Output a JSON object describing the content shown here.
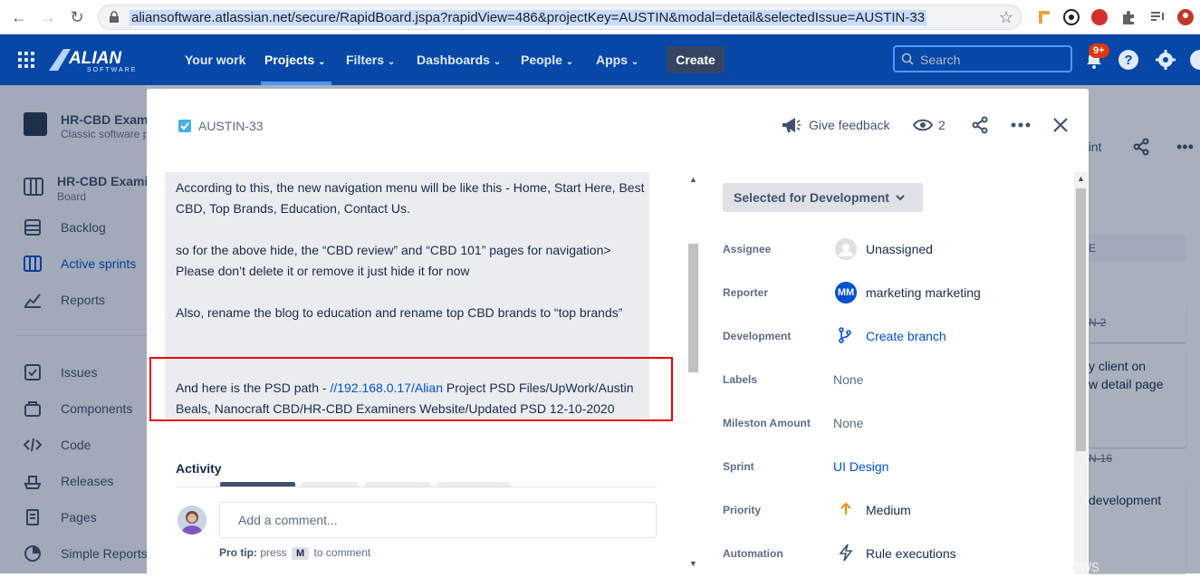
{
  "browser": {
    "url": "aliansoftware.atlassian.net/secure/RapidBoard.jspa?rapidView=486&projectKey=AUSTIN&modal=detail&selectedIssue=AUSTIN-33"
  },
  "topnav": {
    "logo": "ALIAN SOFTWARE",
    "items": [
      "Your work",
      "Projects",
      "Filters",
      "Dashboards",
      "People",
      "Apps"
    ],
    "create_label": "Create",
    "search_placeholder": "Search",
    "notification_count": "9+"
  },
  "sidebar": {
    "project_name": "HR-CBD Exami",
    "project_type": "Classic software p",
    "board_name": "HR-CBD Examir",
    "board_sub": "Board",
    "items": [
      {
        "label": "Backlog",
        "icon": "backlog-icon"
      },
      {
        "label": "Active sprints",
        "icon": "sprints-icon"
      },
      {
        "label": "Reports",
        "icon": "reports-icon"
      },
      {
        "label": "Issues",
        "icon": "issues-icon"
      },
      {
        "label": "Components",
        "icon": "components-icon"
      },
      {
        "label": "Code",
        "icon": "code-icon"
      },
      {
        "label": "Releases",
        "icon": "releases-icon"
      },
      {
        "label": "Pages",
        "icon": "pages-icon"
      },
      {
        "label": "Simple Reports",
        "icon": "simple-reports-icon"
      }
    ]
  },
  "background": {
    "sprint_btn": "rint",
    "card1_key": "N-2",
    "card2_line1": "y client on",
    "card2_line2": "w detail page",
    "card3_key": "N-16",
    "card4_line": "development",
    "col_letter": "E"
  },
  "modal": {
    "issue_key": "AUSTIN-33",
    "feedback_label": "Give feedback",
    "watch_count": "2",
    "description": {
      "p1": "According to this, the new navigation menu will be like this  - Home, Start Here, Best CBD, Top Brands, Education, Contact Us.",
      "p2": "so for the above hide, the “CBD review” and “CBD 101” pages for navigation> Please don’t delete it or remove it just hide it for now",
      "p3": "Also, rename the blog to education and rename top CBD brands to “top brands”",
      "p4_prefix": "And here is the PSD path  - ",
      "p4_link": "//192.168.0.17/Alian",
      "p4_suffix": " Project PSD Files/UpWork/Austin Beals, Nanocraft CBD/HR-CBD Examiners Website/Updated PSD 12-10-2020"
    },
    "activity_title": "Activity",
    "comment_placeholder": "Add a comment...",
    "pro_tip_label": "Pro tip:",
    "pro_tip_press": "press",
    "pro_tip_key": "M",
    "pro_tip_suffix": "to comment",
    "status": "Selected for Development",
    "fields": {
      "assignee": {
        "label": "Assignee",
        "value": "Unassigned"
      },
      "reporter": {
        "label": "Reporter",
        "value": "marketing marketing",
        "initials": "MM"
      },
      "development": {
        "label": "Development",
        "value": "Create branch"
      },
      "labels": {
        "label": "Labels",
        "value": "None"
      },
      "milestone": {
        "label": "Mileston Amount",
        "value": "None"
      },
      "sprint": {
        "label": "Sprint",
        "value": "UI Design"
      },
      "priority": {
        "label": "Priority",
        "value": "Medium"
      },
      "automation": {
        "label": "Automation",
        "value": "Rule executions"
      }
    }
  },
  "watermark": "Activate Windows",
  "colors": {
    "nav": "#0747a6",
    "link": "#0052cc",
    "highlight_box": "#ee0000",
    "priority": "#ff8b00"
  }
}
